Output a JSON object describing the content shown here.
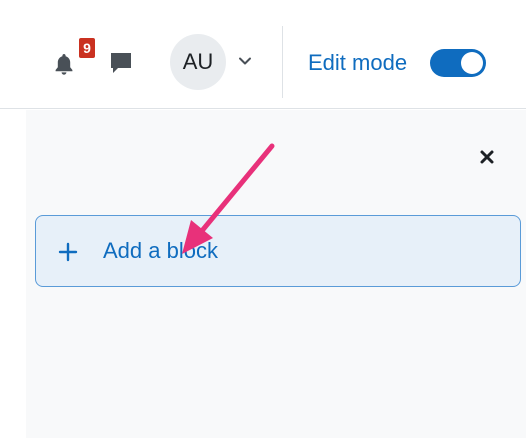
{
  "header": {
    "notifications": {
      "icon": "bell-icon",
      "count": "9"
    },
    "messages": {
      "icon": "chat-icon"
    },
    "user_menu": {
      "initials": "AU",
      "icon": "chevron-down-icon"
    },
    "edit_mode": {
      "label": "Edit mode",
      "enabled": true
    }
  },
  "drawer": {
    "close_icon": "close-icon",
    "add_block": {
      "icon": "plus-icon",
      "label": "Add a block"
    }
  },
  "annotation": {
    "icon": "arrow-pointer-annotation",
    "color": "#e8317a"
  },
  "colors": {
    "accent": "#0f6cbf",
    "badge": "#ca3120",
    "drawer_bg": "#f8f9fa",
    "add_block_bg": "#e7f0f9",
    "add_block_border": "#5a9bd8"
  }
}
